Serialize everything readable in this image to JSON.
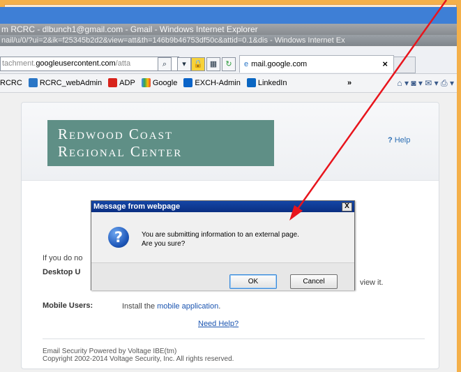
{
  "window": {
    "tab_title": "m RCRC - dlbunch1@gmail.com - Gmail - Windows Internet Explorer",
    "url_line": "nail/u/0/?ui=2&ik=f25345b2d2&view=att&th=146b9b46753df50c&attid=0.1&dis - Windows Internet Ex"
  },
  "address": {
    "prefix": "tachment.",
    "domain": "googleusercontent.com",
    "suffix": "/atta",
    "tab_label": "mail.google.com",
    "tab_close": "×"
  },
  "favorites": {
    "items": [
      {
        "label": "RCRC",
        "icon": "folder-icon",
        "color": "#ffffff"
      },
      {
        "label": "RCRC_webAdmin",
        "icon": "ie-page-icon",
        "color": "#2a76c6"
      },
      {
        "label": "ADP",
        "icon": "adp-icon",
        "color": "#d8241c"
      },
      {
        "label": "Google",
        "icon": "google-icon",
        "color": "#4c8bf5"
      },
      {
        "label": "EXCH-Admin",
        "icon": "outlook-icon",
        "color": "#0a64c8"
      },
      {
        "label": "LinkedIn",
        "icon": "linkedin-icon",
        "color": "#0a66c2"
      }
    ],
    "more": "»"
  },
  "page": {
    "logo_line1": "Redwood Coast",
    "logo_line2": "Regional Center",
    "help_label": "Help",
    "help_icon": "?",
    "if_text": "If you do no",
    "desktop_label": "Desktop U",
    "view_text": "view it.",
    "mobile_label": "Mobile Users:",
    "mobile_text": "Install the ",
    "mobile_link": "mobile application",
    "mobile_end": ".",
    "need_help": "Need Help?",
    "footer1": "Email Security Powered by Voltage IBE(tm)",
    "footer2": "Copyright 2002-2014 Voltage Security, Inc. All rights reserved."
  },
  "dialog": {
    "title": "Message from webpage",
    "close": "X",
    "icon": "?",
    "line1": "You are submitting information to an external page.",
    "line2": "Are you sure?",
    "ok": "OK",
    "cancel": "Cancel"
  },
  "colors": {
    "annotation_arrow": "#e8141c",
    "dialog_title": "#0a2f82",
    "logo_bg": "#5f8f86"
  }
}
